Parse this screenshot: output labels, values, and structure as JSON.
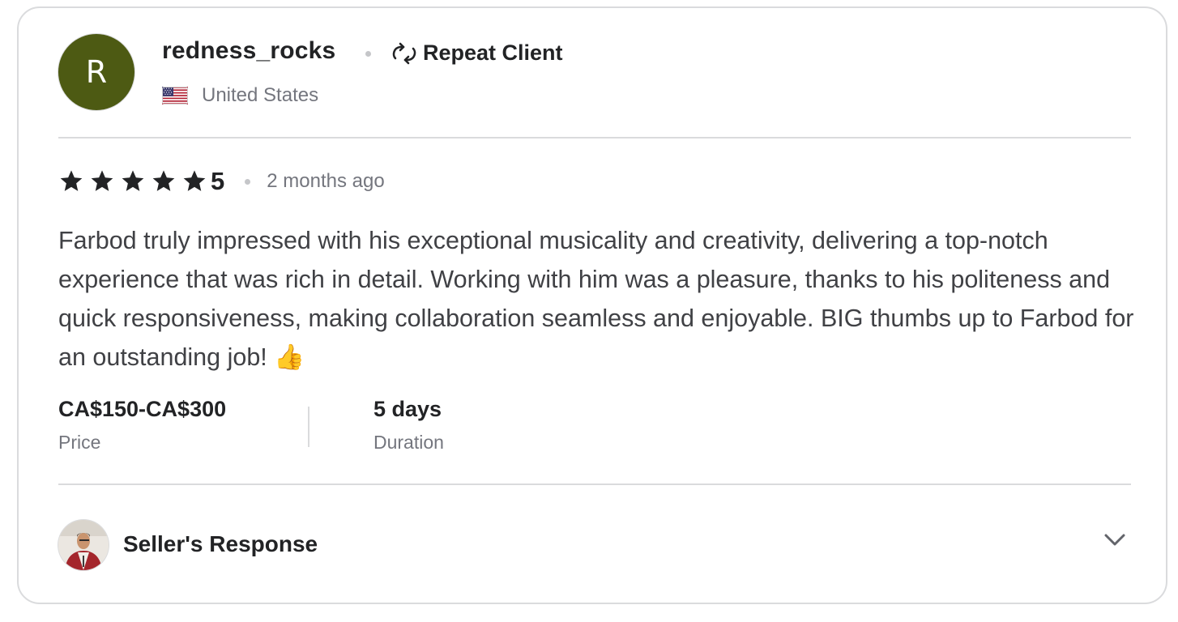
{
  "reviewer": {
    "avatar_initial": "R",
    "avatar_color": "#4d5a13",
    "username": "redness_rocks",
    "badge": "Repeat Client",
    "badge_icon": "repeat-icon",
    "country": "United States",
    "flag_icon": "us-flag-icon"
  },
  "review": {
    "rating": "5",
    "star_count": 5,
    "star_icon": "star-icon",
    "time_ago": "2 months ago",
    "text": "Farbod truly impressed with his exceptional musicality and creativity, delivering a top-notch experience that was rich in detail. Working with him was a pleasure, thanks to his politeness and quick responsiveness, making collaboration seamless and enjoyable. BIG thumbs up to Farbod for an outstanding job! 👍"
  },
  "meta": {
    "price_value": "CA$150-CA$300",
    "price_label": "Price",
    "duration_value": "5 days",
    "duration_label": "Duration"
  },
  "seller_response": {
    "label": "Seller's Response",
    "expand_icon": "chevron-down-icon"
  },
  "colors": {
    "text_primary": "#222325",
    "text_body": "#404145",
    "text_muted": "#74767e",
    "border": "#dadbdd"
  }
}
